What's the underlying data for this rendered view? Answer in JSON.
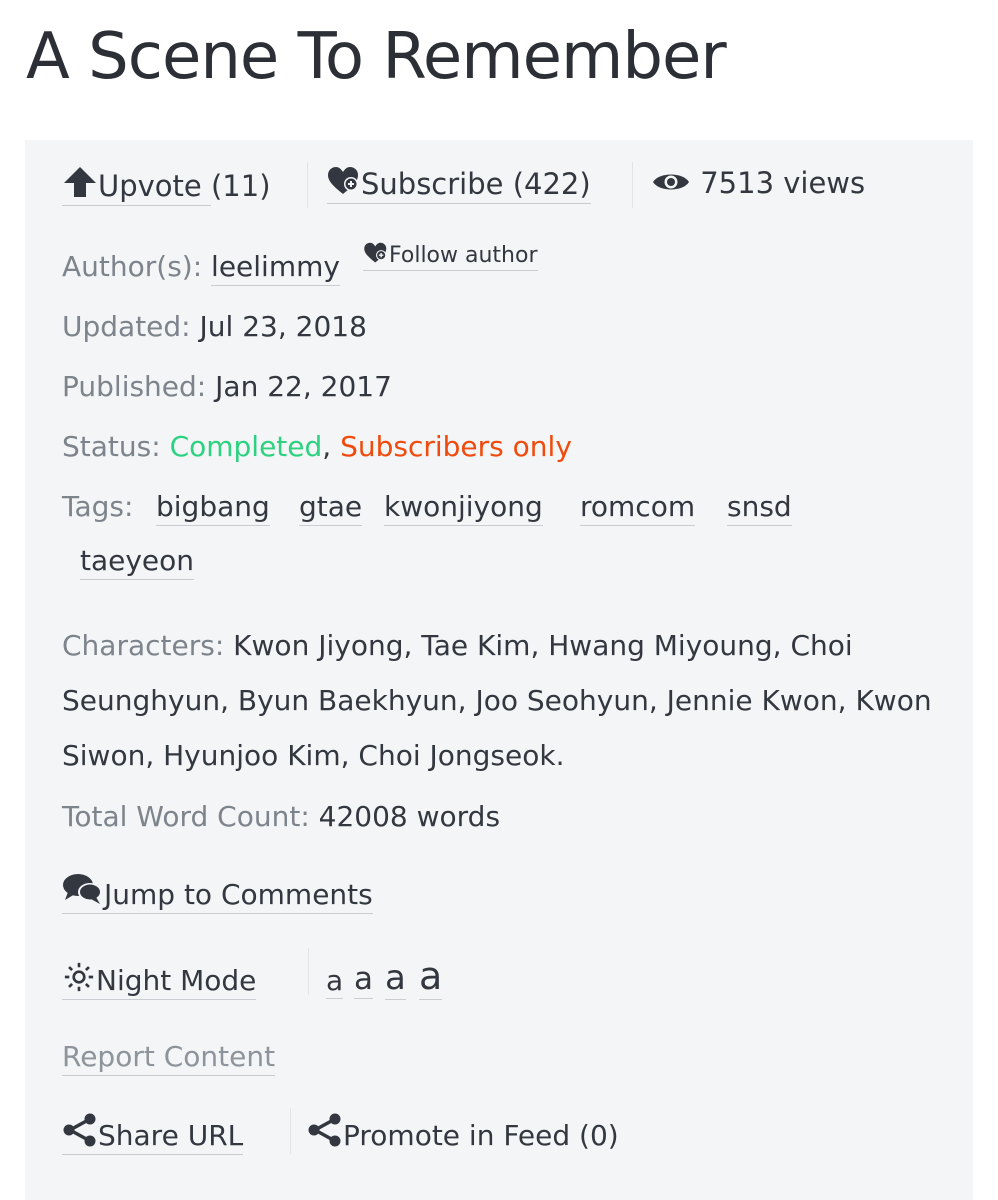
{
  "title": "A Scene To Remember",
  "stats": {
    "upvote_label": "Upvote",
    "upvote_count": "(11)",
    "subscribe_label": "Subscribe",
    "subscribe_count": "(422)",
    "views": "7513 views"
  },
  "author": {
    "label": "Author(s):",
    "name": "leelimmy",
    "follow": "Follow author"
  },
  "updated": {
    "label": "Updated:",
    "value": "Jul 23, 2018"
  },
  "published": {
    "label": "Published:",
    "value": "Jan 22, 2017"
  },
  "status": {
    "label": "Status:",
    "completed": "Completed",
    "comma": ",",
    "subscribers": "Subscribers only"
  },
  "tags": {
    "label": "Tags:",
    "items": [
      "bigbang",
      "gtae",
      "kwonjiyong",
      "romcom",
      "snsd",
      "taeyeon"
    ]
  },
  "characters": {
    "label": "Characters:",
    "value": "Kwon Jiyong, Tae Kim, Hwang Miyoung, Choi Seunghyun, Byun Baekhyun, Joo Seohyun, Jennie Kwon, Kwon Siwon, Hyunjoo Kim, Choi Jongseok."
  },
  "word_count": {
    "label": "Total Word Count:",
    "value": "42008 words"
  },
  "jump_comments": "Jump to Comments",
  "night_mode": "Night Mode",
  "font_sizes": [
    "a",
    "a",
    "a",
    "a"
  ],
  "report": "Report Content",
  "share_url": "Share URL",
  "promote": "Promote in Feed (0)",
  "colors": {
    "completed": "#2dd280",
    "subscribers_only": "#f04a0c",
    "panel_bg": "#f3f5f7"
  }
}
